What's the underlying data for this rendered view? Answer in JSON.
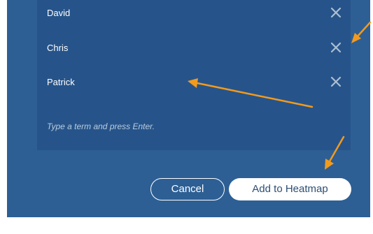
{
  "terms": [
    {
      "label": "David",
      "remove_icon": "close-icon"
    },
    {
      "label": "Chris",
      "remove_icon": "close-icon"
    },
    {
      "label": "Patrick",
      "remove_icon": "close-icon"
    }
  ],
  "input": {
    "placeholder": "Type a term and press Enter.",
    "value": ""
  },
  "actions": {
    "cancel_label": "Cancel",
    "add_label": "Add to Heatmap"
  },
  "colors": {
    "background": "#2d5f94",
    "panel": "#26548a",
    "annotation_arrow": "#f39a1d"
  }
}
